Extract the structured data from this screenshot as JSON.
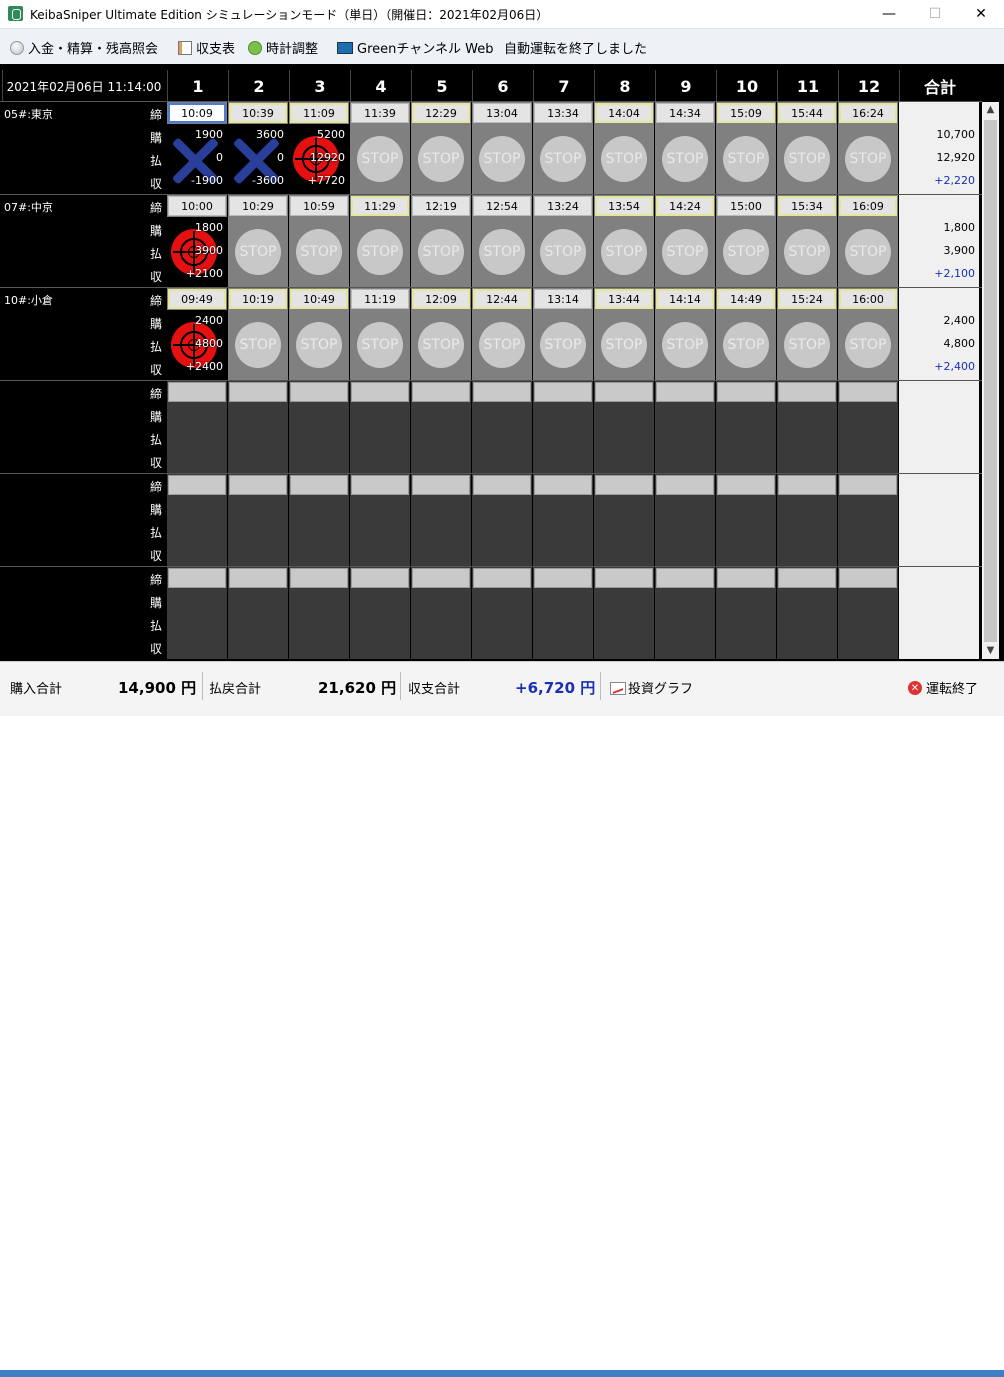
{
  "window": {
    "title": "KeibaSniper Ultimate Edition シミュレーションモード（単日）（開催日：2021年02月06日）",
    "minimize": "—",
    "maximize": "☐",
    "close": "✕"
  },
  "menu": {
    "items": [
      "入金・精算・残高照会",
      "収支表",
      "時計調整",
      "Greenチャンネル Web"
    ],
    "status": "自動運転を終了しました"
  },
  "header": {
    "datetime": "2021年02月06日 11:14:00",
    "races": [
      "1",
      "2",
      "3",
      "4",
      "5",
      "6",
      "7",
      "8",
      "9",
      "10",
      "11",
      "12"
    ],
    "total_label": "合計"
  },
  "row_labels": [
    "締",
    "購",
    "払",
    "収"
  ],
  "venues": [
    {
      "name": "05#:東京",
      "times": [
        "10:09",
        "10:39",
        "11:09",
        "11:39",
        "12:29",
        "13:04",
        "13:34",
        "14:04",
        "14:34",
        "15:09",
        "15:44",
        "16:24"
      ],
      "highlight": [
        "blue",
        "yellow",
        "yellow",
        "none",
        "yellow",
        "none",
        "none",
        "yellow",
        "none",
        "yellow",
        "yellow",
        "yellow"
      ],
      "results": [
        {
          "kind": "cross",
          "buy": "1900",
          "pay": "0",
          "net": "-1900"
        },
        {
          "kind": "cross",
          "buy": "3600",
          "pay": "0",
          "net": "-3600"
        },
        {
          "kind": "target",
          "buy": "5200",
          "pay": "12920",
          "net": "+7720"
        }
      ],
      "total_buy": "10,700",
      "total_pay": "12,920",
      "total_net": "+2,220"
    },
    {
      "name": "07#:中京",
      "times": [
        "10:00",
        "10:29",
        "10:59",
        "11:29",
        "12:19",
        "12:54",
        "13:24",
        "13:54",
        "14:24",
        "15:00",
        "15:34",
        "16:09"
      ],
      "highlight": [
        "none",
        "none",
        "none",
        "yellow",
        "none",
        "none",
        "none",
        "yellow",
        "yellow",
        "none",
        "yellow",
        "yellow"
      ],
      "results": [
        {
          "kind": "target",
          "buy": "1800",
          "pay": "3900",
          "net": "+2100"
        }
      ],
      "total_buy": "1,800",
      "total_pay": "3,900",
      "total_net": "+2,100"
    },
    {
      "name": "10#:小倉",
      "times": [
        "09:49",
        "10:19",
        "10:49",
        "11:19",
        "12:09",
        "12:44",
        "13:14",
        "13:44",
        "14:14",
        "14:49",
        "15:24",
        "16:00"
      ],
      "highlight": [
        "yellow",
        "yellow",
        "yellow",
        "none",
        "yellow",
        "yellow",
        "none",
        "yellow",
        "yellow",
        "yellow",
        "yellow",
        "yellow"
      ],
      "results": [
        {
          "kind": "target",
          "buy": "2400",
          "pay": "4800",
          "net": "+2400"
        }
      ],
      "total_buy": "2,400",
      "total_pay": "4,800",
      "total_net": "+2,400"
    }
  ],
  "empty_venue_count": 3,
  "stop_label": "STOP",
  "footer": {
    "buy_label": "購入合計",
    "buy_value": "14,900 円",
    "payout_label": "払戻合計",
    "payout_value": "21,620 円",
    "balance_label": "収支合計",
    "balance_value": "+6,720 円",
    "graph_label": "投資グラフ",
    "exit_label": "運転終了"
  },
  "colors": {
    "profit": "#1a2fb5",
    "stop_bg": "#808080",
    "highlight_yellow": "#e6e69a",
    "highlight_blue": "#4a7bd8"
  }
}
